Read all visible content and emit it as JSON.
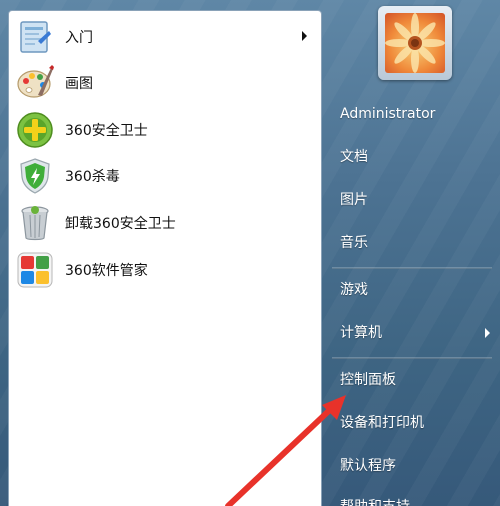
{
  "programs": [
    {
      "label": "入门",
      "icon": "getting-started-icon",
      "has_submenu": true
    },
    {
      "label": "画图",
      "icon": "paint-palette-icon",
      "has_submenu": false
    },
    {
      "label": "360安全卫士",
      "icon": "360-safe-guard-icon",
      "has_submenu": false
    },
    {
      "label": "360杀毒",
      "icon": "360-antivirus-shield-icon",
      "has_submenu": false
    },
    {
      "label": "卸载360安全卫士",
      "icon": "uninstall-trash-icon",
      "has_submenu": false
    },
    {
      "label": "360软件管家",
      "icon": "360-software-manager-icon",
      "has_submenu": false
    }
  ],
  "user": {
    "name": "Administrator",
    "picture": "flower-avatar-icon"
  },
  "right_items": {
    "documents": "文档",
    "pictures": "图片",
    "music": "音乐",
    "games": "游戏",
    "computer": "计算机",
    "control_panel": "控制面板",
    "devices_printers": "设备和打印机",
    "default_programs": "默认程序",
    "help_support": "帮助和支持"
  },
  "annotation": {
    "color": "#e8322a"
  }
}
